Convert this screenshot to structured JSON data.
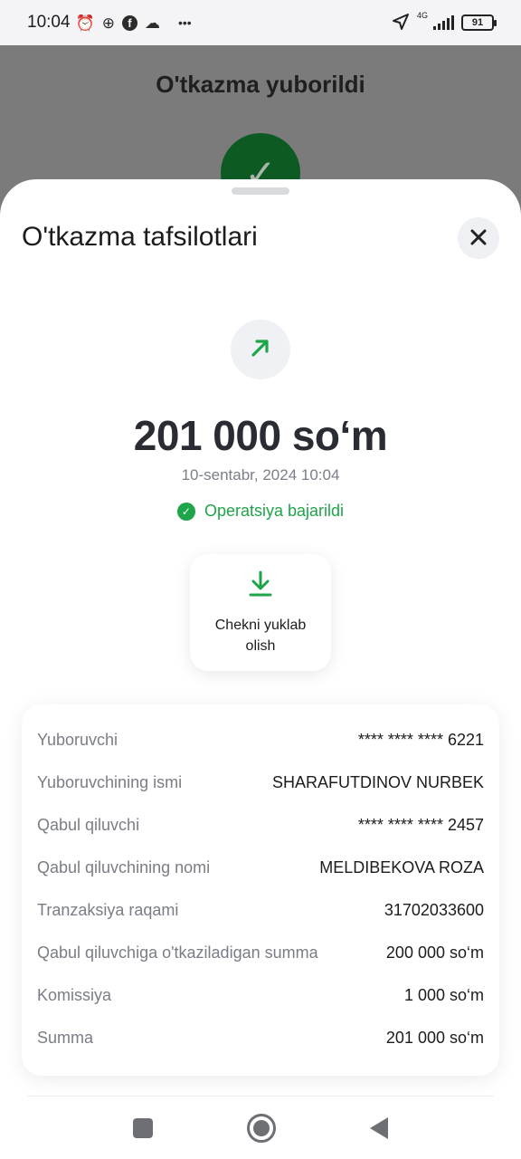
{
  "status_bar": {
    "time": "10:04",
    "network": "4G",
    "battery": "91",
    "more": "•••"
  },
  "background": {
    "title": "O'tkazma yuborildi"
  },
  "sheet": {
    "title": "O'tkazma tafsilotlari",
    "amount": "201 000 so‘m",
    "date": "10-sentabr, 2024 10:04",
    "status": "Operatsiya bajarildi",
    "download_label": "Chekni yuklab olish",
    "colors": {
      "accent_green": "#1ea54a",
      "amount_text": "#2a2c33"
    }
  },
  "details": [
    {
      "label": "Yuboruvchi",
      "value": "**** **** **** 6221"
    },
    {
      "label": "Yuboruvchining ismi",
      "value": "SHARAFUTDINOV NURBEK"
    },
    {
      "label": "Qabul qiluvchi",
      "value": "**** **** **** 2457"
    },
    {
      "label": "Qabul qiluvchining nomi",
      "value": "MELDIBEKOVA ROZA"
    },
    {
      "label": "Tranzaksiya raqami",
      "value": "31702033600"
    },
    {
      "label": "Qabul qiluvchiga o'tkaziladigan summa",
      "value": "200 000 so‘m"
    },
    {
      "label": "Komissiya",
      "value": "1 000 so‘m"
    },
    {
      "label": "Summa",
      "value": "201 000 so‘m"
    }
  ]
}
